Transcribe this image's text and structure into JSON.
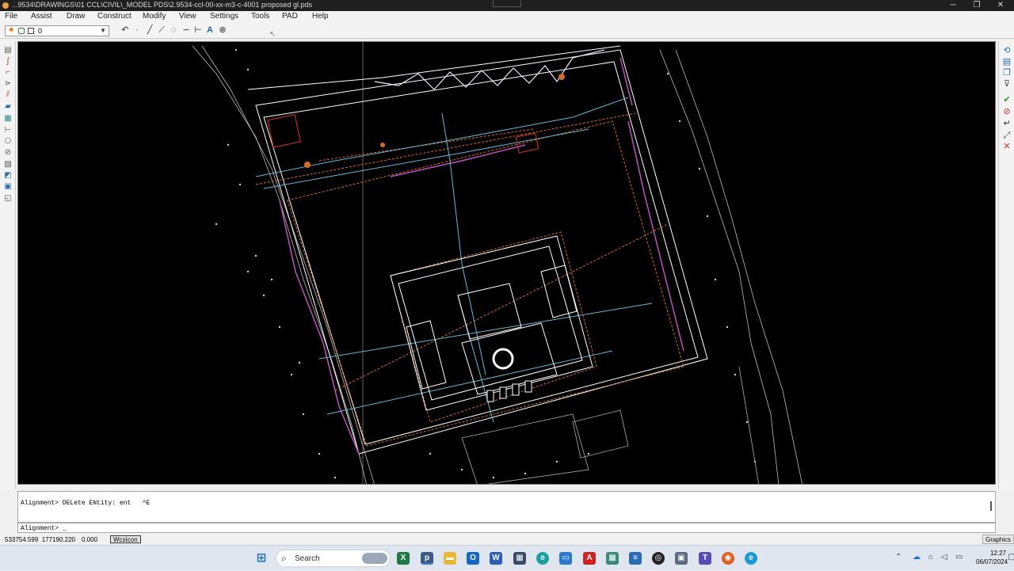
{
  "window": {
    "title": "...9534\\DRAWINGS\\01 CCL\\CIVIL\\_MODEL PDS\\2.9534-ccl-00-xx-m3-c-4001 proposed gl.pds",
    "minimize": "─",
    "restore": "❐",
    "close": "✕"
  },
  "menu": [
    "File",
    "Assist",
    "Draw",
    "Construct",
    "Modify",
    "View",
    "Settings",
    "Tools",
    "PAD",
    "Help"
  ],
  "toolbar": {
    "layer_value": "0",
    "icons": [
      "undo-icon",
      "dot-icon",
      "line-icon",
      "polyline-icon",
      "circle-icon",
      "arc-icon",
      "dimension-icon",
      "text-icon",
      "hatch-icon"
    ]
  },
  "command": {
    "history": "Alignment> DELete ENtity: ent   ^E",
    "prompt": "Alignment> _"
  },
  "status": {
    "coordinates": "533754.599  177190.220",
    "z_value": "0.000",
    "wcs_button": "WcsIcon",
    "graphics_button": "Graphics"
  },
  "taskbar": {
    "search_placeholder": "Search",
    "time": "12:27",
    "date": "06/07/2024"
  },
  "colors": {
    "cad_background": "#000000",
    "accent_orange": "#d86a20",
    "accent_cyan": "#5fb8d8",
    "accent_magenta": "#c050c0"
  }
}
